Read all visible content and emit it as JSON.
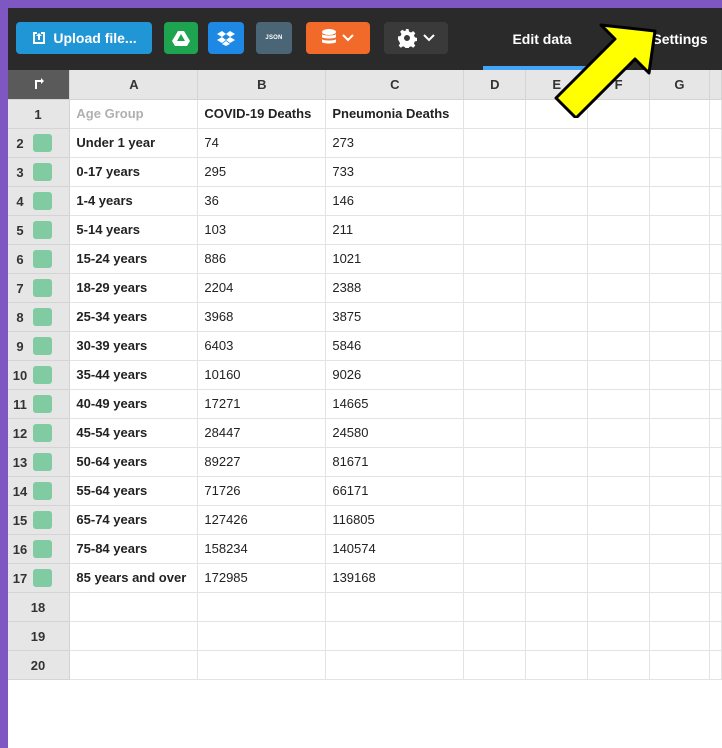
{
  "toolbar": {
    "upload_label": "Upload file...",
    "json_label": "JSON",
    "tabs": [
      {
        "label": "Edit data",
        "active": true
      },
      {
        "label": "Settings",
        "active": false
      }
    ],
    "icons": {
      "upload": "upload-icon",
      "drive": "google-drive-icon",
      "dropbox": "dropbox-icon",
      "database": "database-icon",
      "gear": "gear-icon",
      "chevron": "chevron-down-icon"
    }
  },
  "sheet": {
    "columns": [
      "A",
      "B",
      "C",
      "D",
      "E",
      "F",
      "G"
    ],
    "rows": [
      {
        "n": "1",
        "a": "Age Group",
        "b": "COVID-19 Deaths",
        "c": "Pneumonia Deaths"
      },
      {
        "n": "2",
        "a": "Under 1 year",
        "b": "74",
        "c": "273"
      },
      {
        "n": "3",
        "a": "0-17 years",
        "b": "295",
        "c": "733"
      },
      {
        "n": "4",
        "a": "1-4 years",
        "b": "36",
        "c": "146"
      },
      {
        "n": "5",
        "a": "5-14 years",
        "b": "103",
        "c": "211"
      },
      {
        "n": "6",
        "a": "15-24 years",
        "b": "886",
        "c": "1021"
      },
      {
        "n": "7",
        "a": "18-29 years",
        "b": "2204",
        "c": "2388"
      },
      {
        "n": "8",
        "a": "25-34 years",
        "b": "3968",
        "c": "3875"
      },
      {
        "n": "9",
        "a": "30-39 years",
        "b": "6403",
        "c": "5846"
      },
      {
        "n": "10",
        "a": "35-44 years",
        "b": "10160",
        "c": "9026"
      },
      {
        "n": "11",
        "a": "40-49 years",
        "b": "17271",
        "c": "14665"
      },
      {
        "n": "12",
        "a": "45-54 years",
        "b": "28447",
        "c": "24580"
      },
      {
        "n": "13",
        "a": "50-64 years",
        "b": "89227",
        "c": "81671"
      },
      {
        "n": "14",
        "a": "55-64 years",
        "b": "71726",
        "c": "66171"
      },
      {
        "n": "15",
        "a": "65-74 years",
        "b": "127426",
        "c": "116805"
      },
      {
        "n": "16",
        "a": "75-84 years",
        "b": "158234",
        "c": "140574"
      },
      {
        "n": "17",
        "a": "85 years and over",
        "b": "172985",
        "c": "139168"
      },
      {
        "n": "18",
        "a": "",
        "b": "",
        "c": ""
      },
      {
        "n": "19",
        "a": "",
        "b": "",
        "c": ""
      },
      {
        "n": "20",
        "a": "",
        "b": "",
        "c": ""
      }
    ]
  },
  "colors": {
    "background": "#7e57c2",
    "toolbar": "#2a2a2a",
    "row_swatch": "#80cba2",
    "annotation_arrow": "#ffff00"
  }
}
